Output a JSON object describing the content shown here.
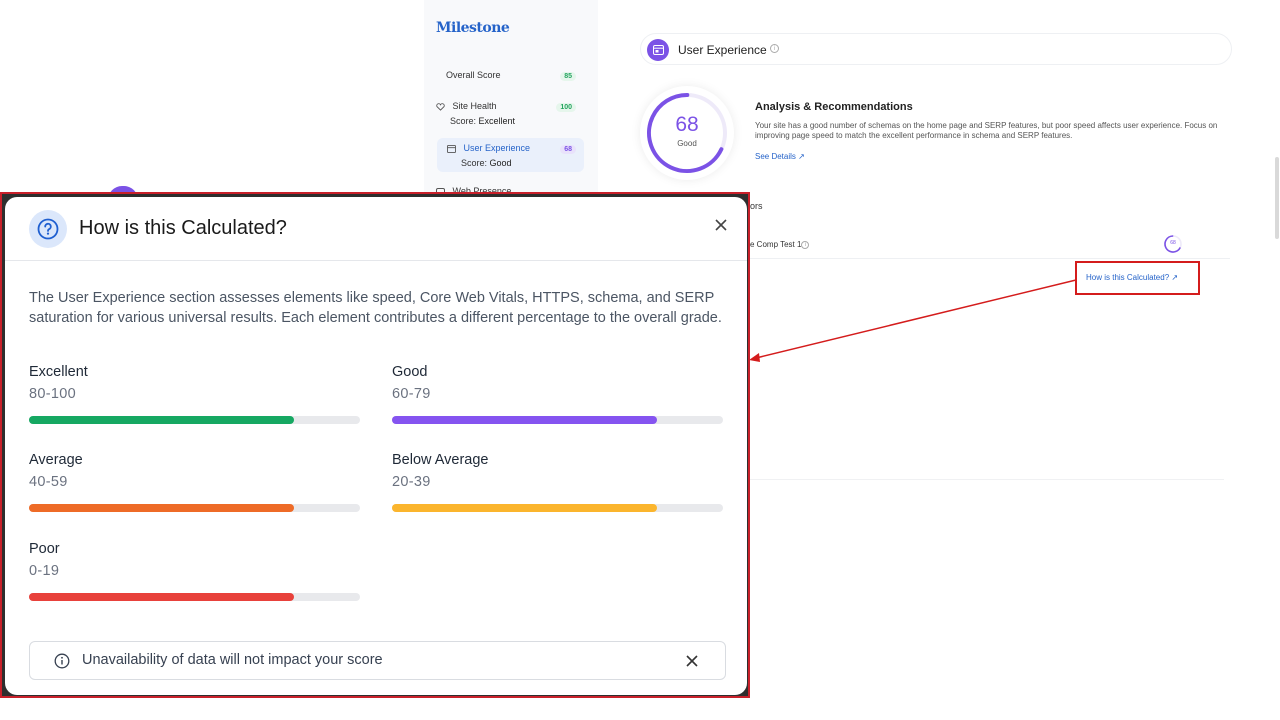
{
  "app": {
    "logo": "Milestone"
  },
  "sidebar": {
    "overall": {
      "label": "Overall Score",
      "score": "85",
      "score_color": "#22a45d"
    },
    "items": [
      {
        "label": "Site Health",
        "sub_prefix": "Score:",
        "sub_value": "Excellent",
        "score": "100",
        "score_color": "#22a45d"
      },
      {
        "label": "User Experience",
        "sub_prefix": "Score:",
        "sub_value": "Good",
        "score": "68",
        "score_color": "#7b52e6"
      },
      {
        "label": "Web Presence",
        "score": "..."
      }
    ]
  },
  "main": {
    "section_title": "User Experience",
    "gauge": {
      "value": "68",
      "label": "Good",
      "fraction": 0.68,
      "color": "#7b52e6"
    },
    "analysis": {
      "title": "Analysis & Recommendations",
      "body": "Your site has a good number of schemas on the home page and SERP features, but poor speed affects user experience. Focus on improving page speed to match the excellent performance in schema and SERP features.",
      "link": "See Details ↗"
    },
    "factors_label": "ors",
    "comp_row": {
      "label": "e Comp Test 1",
      "score": "68"
    },
    "calc_link": "How is this Calculated?  ↗"
  },
  "modal": {
    "title": "How is this Calculated?",
    "description": "The User Experience section assesses elements like speed, Core Web Vitals, HTTPS, schema, and SERP saturation for various universal results. Each element contributes a different percentage to the overall grade.",
    "tiers": [
      {
        "name": "Excellent",
        "range": "80-100",
        "color": "#16a862",
        "fill": 0.8
      },
      {
        "name": "Good",
        "range": "60-79",
        "color": "#8554f0",
        "fill": 0.8
      },
      {
        "name": "Average",
        "range": "40-59",
        "color": "#ee6b27",
        "fill": 0.8
      },
      {
        "name": "Below Average",
        "range": "20-39",
        "color": "#fbb52d",
        "fill": 0.8
      },
      {
        "name": "Poor",
        "range": "0-19",
        "color": "#e8413b",
        "fill": 0.8
      }
    ],
    "notice": "Unavailability of data will not impact your score"
  },
  "annotation": {
    "highlight_color": "#d41c1c",
    "arrow_color": "#d41c1c"
  }
}
